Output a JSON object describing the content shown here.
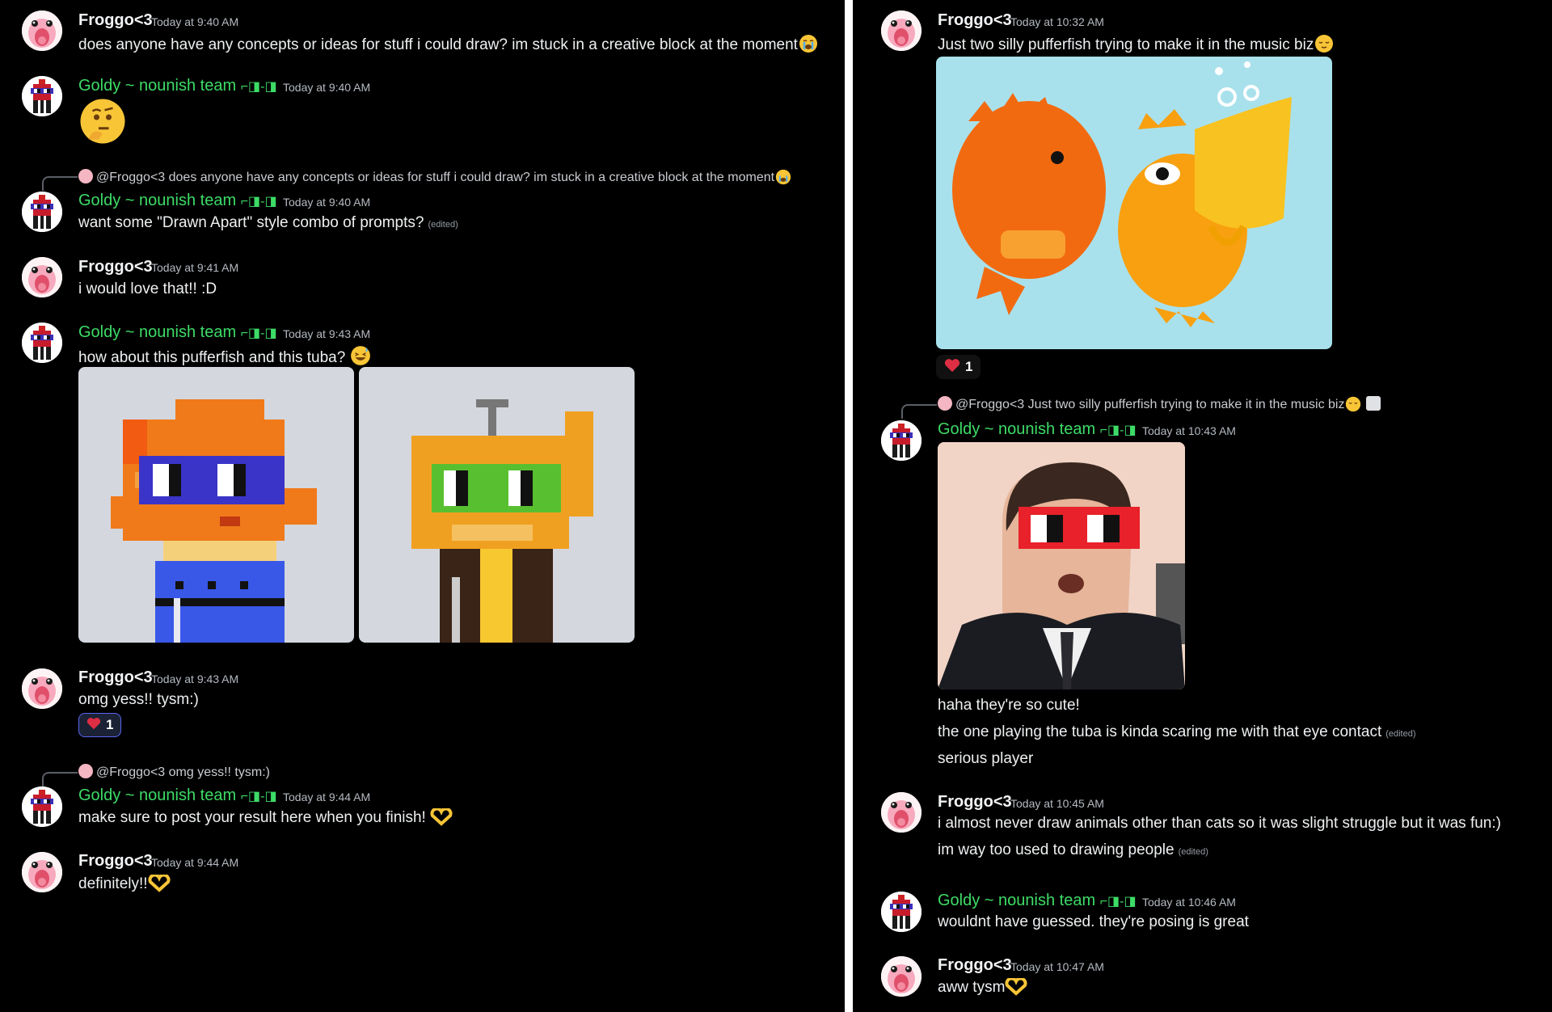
{
  "users": {
    "froggo": "Froggo<3",
    "goldy": "Goldy ~ nounish team",
    "goldy_badge": "⌐◨-◨"
  },
  "left": {
    "m1": {
      "time": "Today at 9:40 AM",
      "text": "does anyone have any concepts or ideas for stuff i could draw? im stuck in a creative block at the moment",
      "emoji": "loudly-crying-emoji"
    },
    "m2": {
      "time": "Today at 9:40 AM",
      "emoji": "thinking-emoji"
    },
    "m3": {
      "reply_to": "@Froggo<3 does anyone have any concepts or ideas for stuff i could draw? im stuck in a creative block at the moment",
      "time": "Today at 9:40 AM",
      "text": "want some \"Drawn Apart\" style combo of prompts?",
      "edited": "(edited)"
    },
    "m4": {
      "time": "Today at 9:41 AM",
      "text": "i would love that!! :D"
    },
    "m5": {
      "time": "Today at 9:43 AM",
      "text": "how about this pufferfish and this tuba?",
      "emoji": "grinning-sweat-emoji"
    },
    "m6": {
      "time": "Today at 9:43 AM",
      "text": "omg yess!! tysm:)",
      "reaction_count": "1"
    },
    "m7": {
      "reply_to": "@Froggo<3 omg yess!! tysm:)",
      "time": "Today at 9:44 AM",
      "text": "make sure to post your result here when you finish!",
      "emoji": "heart-hands-emoji"
    },
    "m8": {
      "time": "Today at 9:44 AM",
      "text": "definitely!!",
      "emoji": "heart-hands-emoji"
    }
  },
  "right": {
    "m1": {
      "time": "Today at 10:32 AM",
      "text": "Just two silly pufferfish trying to make it in the music biz",
      "emoji": "relieved-emoji",
      "reaction_count": "1"
    },
    "m2": {
      "reply_to": "@Froggo<3 Just two silly pufferfish trying to make it in the music biz",
      "time": "Today at 10:43 AM",
      "lines": [
        "haha they're so cute!",
        "the one playing the tuba is kinda scaring me with that eye contact",
        "serious player"
      ],
      "edited": "(edited)"
    },
    "m3": {
      "time": "Today at 10:45 AM",
      "lines": [
        "i almost never draw animals other than cats so it was slight struggle but it was fun:)",
        "im way too used to drawing people"
      ],
      "edited": "(edited)"
    },
    "m4": {
      "time": "Today at 10:46 AM",
      "text": "wouldnt have guessed. they're posing is great"
    },
    "m5": {
      "time": "Today at 10:47 AM",
      "text": "aww tysm",
      "emoji": "heart-hands-emoji"
    }
  },
  "colors": {
    "goldy_name": "#3ddc67",
    "reaction_border": "#5865f2",
    "background": "#000000"
  }
}
